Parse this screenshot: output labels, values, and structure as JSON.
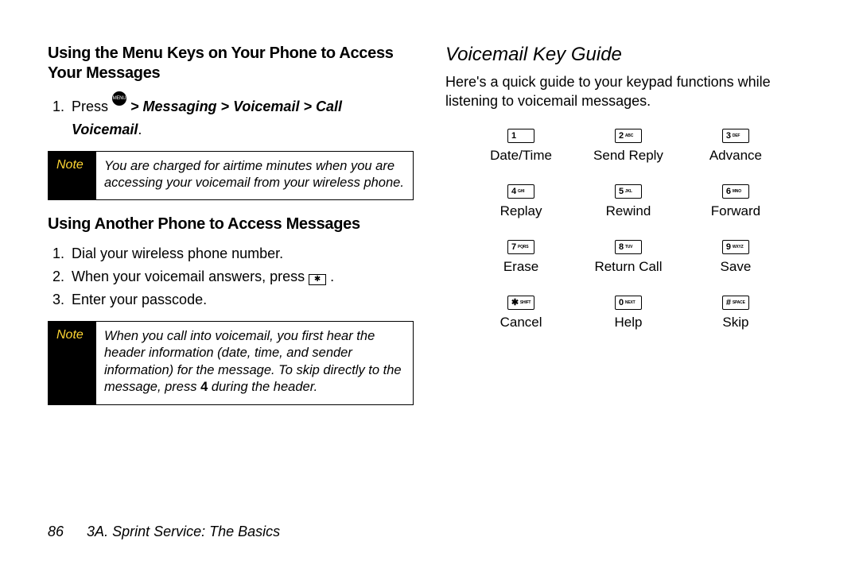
{
  "left": {
    "heading1": "Using the Menu Keys on Your Phone to Access Your Messages",
    "step1_prefix": "Press ",
    "step1_icon": "MENU OK",
    "step1_path": " > Messaging > Voicemail > Call Voicemail",
    "note1_label": "Note",
    "note1_text": "You are charged for airtime minutes when you are accessing your voicemail from your wireless phone.",
    "heading2": "Using Another Phone to Access Messages",
    "step2_1": "Dial your wireless phone number.",
    "step2_2a": "When your voicemail answers, press ",
    "step2_2_icon": "✱",
    "step2_2b": " .",
    "step2_3": "Enter your passcode.",
    "note2_label": "Note",
    "note2_text_a": "When you call into voicemail, you first hear the header information (date, time, and sender information) for the message. To skip directly to the message, press ",
    "note2_text_bold": "4",
    "note2_text_b": " during the header."
  },
  "right": {
    "title": "Voicemail Key Guide",
    "intro": "Here's a quick guide to your keypad functions while listening to voicemail messages.",
    "keys": [
      {
        "num": "1",
        "sub": "",
        "label": "Date/Time"
      },
      {
        "num": "2",
        "sub": "ABC",
        "label": "Send Reply"
      },
      {
        "num": "3",
        "sub": "DEF",
        "label": "Advance"
      },
      {
        "num": "4",
        "sub": "GHI",
        "label": "Replay"
      },
      {
        "num": "5",
        "sub": "JKL",
        "label": "Rewind"
      },
      {
        "num": "6",
        "sub": "MNO",
        "label": "Forward"
      },
      {
        "num": "7",
        "sub": "PQRS",
        "label": "Erase"
      },
      {
        "num": "8",
        "sub": "TUV",
        "label": "Return Call"
      },
      {
        "num": "9",
        "sub": "WXYZ",
        "label": "Save"
      },
      {
        "num": "✱",
        "sub": "SHIFT",
        "label": "Cancel"
      },
      {
        "num": "0",
        "sub": "NEXT",
        "label": "Help"
      },
      {
        "num": "#",
        "sub": "SPACE",
        "label": "Skip"
      }
    ]
  },
  "footer": {
    "page": "86",
    "chapter": "3A. Sprint Service: The Basics"
  }
}
